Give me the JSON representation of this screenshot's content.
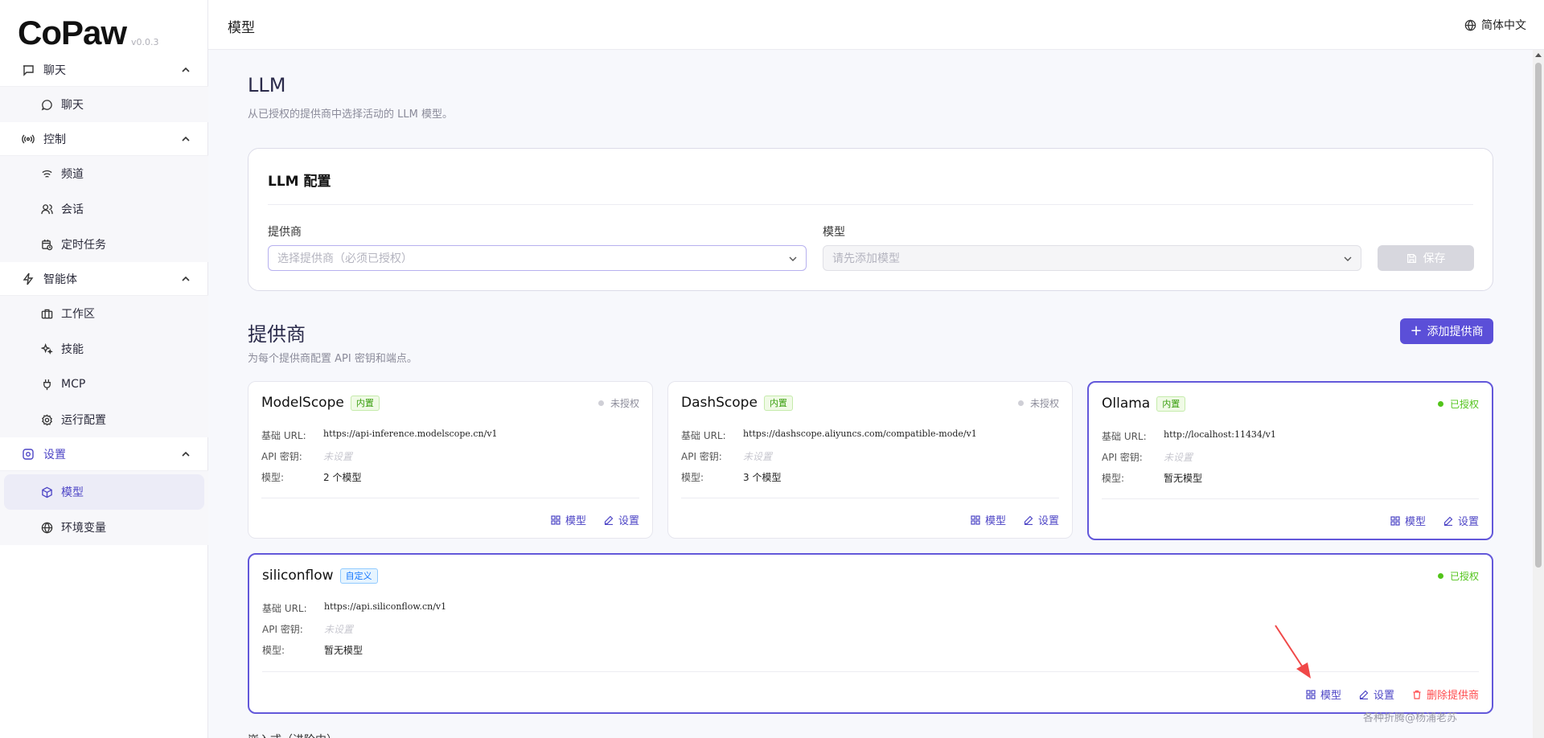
{
  "app": {
    "logo": "CoPaw",
    "version": "v0.0.3"
  },
  "header": {
    "title": "模型",
    "language": "简体中文"
  },
  "sidebar": {
    "groups": [
      {
        "label": "聊天",
        "icon": "message-square-icon",
        "items": [
          {
            "label": "聊天",
            "icon": "message-circle-icon"
          }
        ]
      },
      {
        "label": "控制",
        "icon": "radio-icon",
        "items": [
          {
            "label": "频道",
            "icon": "wifi-icon"
          },
          {
            "label": "会话",
            "icon": "users-icon"
          },
          {
            "label": "定时任务",
            "icon": "calendar-clock-icon"
          }
        ]
      },
      {
        "label": "智能体",
        "icon": "zap-icon",
        "items": [
          {
            "label": "工作区",
            "icon": "briefcase-icon"
          },
          {
            "label": "技能",
            "icon": "sparkles-icon"
          },
          {
            "label": "MCP",
            "icon": "plug-icon"
          },
          {
            "label": "运行配置",
            "icon": "settings-icon"
          }
        ]
      },
      {
        "label": "设置",
        "icon": "settings-gear-icon",
        "items": [
          {
            "label": "模型",
            "icon": "box-icon"
          },
          {
            "label": "环境变量",
            "icon": "globe-icon"
          }
        ]
      }
    ]
  },
  "llm": {
    "title": "LLM",
    "subtitle": "从已授权的提供商中选择活动的 LLM 模型。",
    "config_title": "LLM 配置",
    "provider_label": "提供商",
    "provider_placeholder": "选择提供商（必须已授权）",
    "model_label": "模型",
    "model_placeholder": "请先添加模型",
    "save_label": "保存"
  },
  "providers": {
    "title": "提供商",
    "subtitle": "为每个提供商配置 API 密钥和端点。",
    "add_label": "添加提供商",
    "field_labels": {
      "base_url": "基础 URL:",
      "api_key": "API 密钥:",
      "models": "模型:"
    },
    "action_labels": {
      "models": "模型",
      "settings": "设置",
      "delete": "删除提供商"
    },
    "cards": [
      {
        "name": "ModelScope",
        "tag": "内置",
        "status": "未授权",
        "base_url": "https://api-inference.modelscope.cn/v1",
        "api_key": "未设置",
        "models": "2 个模型"
      },
      {
        "name": "DashScope",
        "tag": "内置",
        "status": "未授权",
        "base_url": "https://dashscope.aliyuncs.com/compatible-mode/v1",
        "api_key": "未设置",
        "models": "3 个模型"
      },
      {
        "name": "Ollama",
        "tag": "内置",
        "status": "已授权",
        "base_url": "http://localhost:11434/v1",
        "api_key": "未设置",
        "models": "暂无模型"
      },
      {
        "name": "siliconflow",
        "tag": "自定义",
        "status": "已授权",
        "base_url": "https://api.siliconflow.cn/v1",
        "api_key": "未设置",
        "models": "暂无模型"
      }
    ]
  },
  "bottom_section": "嵌入式（进阶中）",
  "watermark": "各种折腾@杨浦老苏",
  "colors": {
    "accent": "#5b4fd8",
    "authorized": "#52c41a",
    "danger": "#ff4d4f"
  }
}
